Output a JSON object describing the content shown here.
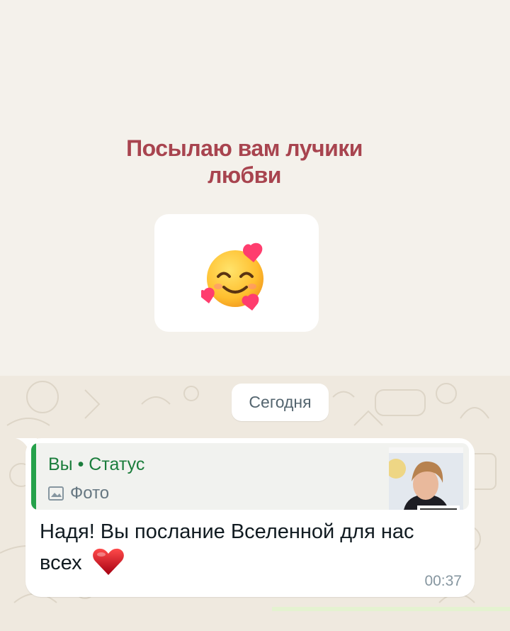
{
  "status_post": {
    "caption": "Посылаю вам лучики любви",
    "emoji_icon": "smiling-face-with-hearts-icon",
    "card_background": "#ffffff",
    "caption_color": "#a8444f"
  },
  "chat": {
    "date_separator": "Сегодня",
    "message": {
      "quote": {
        "title": "Вы • Статус",
        "subtitle": "Фото",
        "subtitle_icon": "photo-icon",
        "accent_color": "#25a14a",
        "thumbnail_icon": "status-photo-thumbnail"
      },
      "text": "Надя! Вы послание Вселенной для нас всех",
      "text_emoji": "red-heart-icon",
      "time": "00:37"
    }
  }
}
